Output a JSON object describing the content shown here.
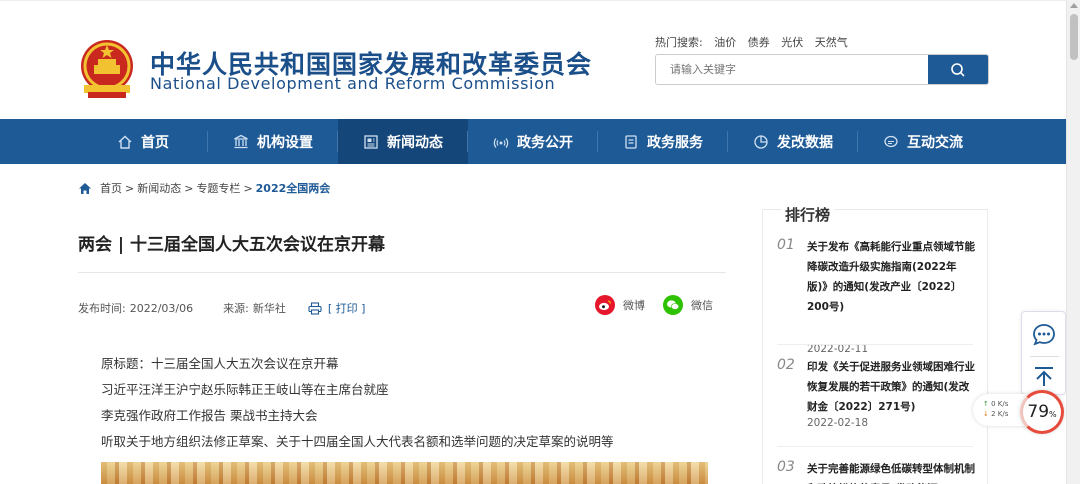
{
  "header": {
    "title_cn": "中华人民共和国国家发展和改革委员会",
    "title_en": "National Development and Reform Commission",
    "hot_label": "热门搜索:",
    "hot_terms": [
      "油价",
      "债券",
      "光伏",
      "天然气"
    ],
    "search_placeholder": "请输入关键字"
  },
  "nav": {
    "items": [
      {
        "label": "首页",
        "icon": "home-icon"
      },
      {
        "label": "机构设置",
        "icon": "institution-icon"
      },
      {
        "label": "新闻动态",
        "icon": "news-icon",
        "active": true
      },
      {
        "label": "政务公开",
        "icon": "broadcast-icon"
      },
      {
        "label": "政务服务",
        "icon": "service-icon"
      },
      {
        "label": "发改数据",
        "icon": "pie-chart-icon"
      },
      {
        "label": "互动交流",
        "icon": "chat-icon"
      }
    ]
  },
  "breadcrumb": {
    "items": [
      "首页",
      "新闻动态",
      "专题专栏"
    ],
    "separator": ">",
    "current": "2022全国两会"
  },
  "article": {
    "title": "两会 | 十三届全国人大五次会议在京开幕",
    "publish_label": "发布时间:",
    "publish_date": "2022/03/06",
    "source_label": "来源:",
    "source": "新华社",
    "print_label": "[ 打印 ]",
    "share_weibo": "微博",
    "share_wechat": "微信",
    "paragraphs": [
      "原标题：十三届全国人大五次会议在京开幕",
      "习近平汪洋王沪宁赵乐际韩正王岐山等在主席台就座",
      "李克强作政府工作报告 栗战书主持大会",
      "听取关于地方组织法修正草案、关于十四届全国人大代表名额和选举问题的决定草案的说明等"
    ]
  },
  "ranking": {
    "title": "排行榜",
    "items": [
      {
        "num": "01",
        "text": "关于发布《高耗能行业重点领域节能降碳改造升级实施指南(2022年版)》的通知(发改产业〔2022〕200号)",
        "date": "2022-02-11"
      },
      {
        "num": "02",
        "text": "印发《关于促进服务业领域困难行业恢复发展的若干政策》的通知(发改财金〔2022〕271号)",
        "date": "2022-02-18"
      },
      {
        "num": "03",
        "text": "关于完善能源绿色低碳转型体制机制和政策措施的意见(发改能源",
        "date": ""
      }
    ]
  },
  "widgets": {
    "speed_up": "0 K/s",
    "speed_down": "2 K/s",
    "gauge_value": "79",
    "gauge_unit": "%"
  },
  "colors": {
    "brand_blue": "#1e5a96",
    "nav_active": "#154679",
    "weibo_red": "#e6162d",
    "wechat_green": "#2dc100"
  }
}
